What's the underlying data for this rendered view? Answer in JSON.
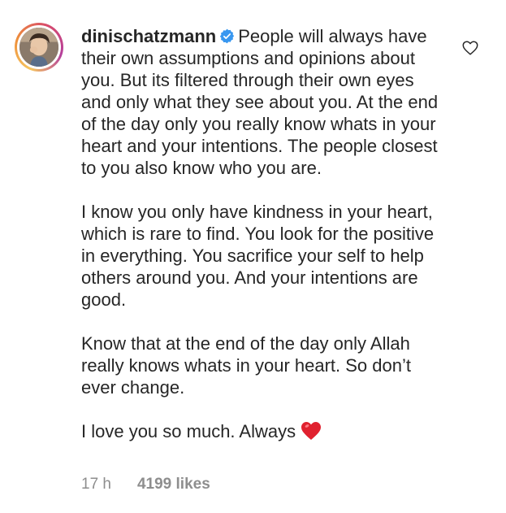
{
  "comment": {
    "username": "dinischatzmann",
    "verified": true,
    "first_line_text": "People will always have their own assumptions and opinions about you. But its filtered through their own eyes and only what they see about you. At the end of the day only you really know whats in your heart and your intentions. The people closest to you also know who you are.",
    "paragraph_2": "I know you only have kindness in your heart, which is rare to find. You look for the positive in everything. You sacrifice your self to help others around you. And your intentions are good.",
    "paragraph_3": "Know that at the end of the day only Allah really knows whats in your heart. So don’t ever change.",
    "paragraph_4": "I love you so much. Always",
    "emoji": "red-heart",
    "time": "17 h",
    "likes": "4199 likes"
  },
  "icons": {
    "verified_badge": "verified-check-icon",
    "like": "heart-outline-icon"
  },
  "colors": {
    "text": "#262626",
    "meta": "#8e8e8e",
    "verified": "#3897f0",
    "heart": "#e0212f"
  }
}
